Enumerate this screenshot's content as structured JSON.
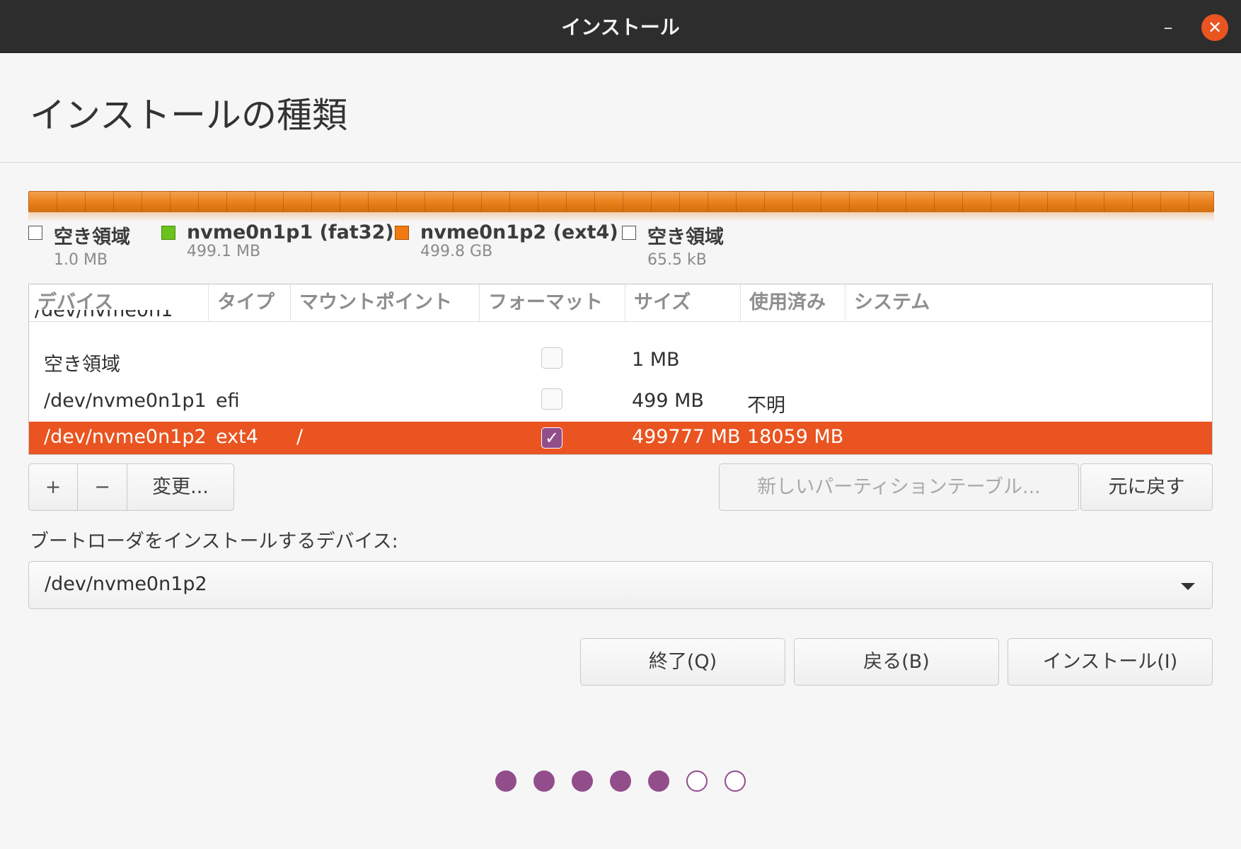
{
  "window": {
    "title": "インストール",
    "minimize_glyph": "–",
    "close_glyph": "✕"
  },
  "page": {
    "heading": "インストールの種類"
  },
  "legend": [
    {
      "name": "空き領域",
      "size": "1.0 MB",
      "color": "#ffffff"
    },
    {
      "name": "nvme0n1p1 (fat32)",
      "size": "499.1 MB",
      "color": "#6ac21c"
    },
    {
      "name": "nvme0n1p2 (ext4)",
      "size": "499.8 GB",
      "color": "#f07a10"
    },
    {
      "name": "空き領域",
      "size": "65.5 kB",
      "color": "#ffffff"
    }
  ],
  "table": {
    "columns": [
      "デバイス",
      "タイプ",
      "マウントポイント",
      "フォーマット",
      "サイズ",
      "使用済み",
      "システム"
    ],
    "group_label": "/dev/nvme0n1",
    "rows": [
      {
        "device": "空き領域",
        "type": "",
        "mount": "",
        "format": false,
        "size": "1 MB",
        "used": "",
        "system": ""
      },
      {
        "device": "/dev/nvme0n1p1",
        "type": "efi",
        "mount": "",
        "format": false,
        "size": "499 MB",
        "used": "不明",
        "system": ""
      },
      {
        "device": "/dev/nvme0n1p2",
        "type": "ext4",
        "mount": "/",
        "format": true,
        "size": "499777 MB",
        "used": "18059 MB",
        "system": "",
        "selected": true
      }
    ],
    "check_glyph": "✓"
  },
  "toolbar": {
    "add_label": "+",
    "remove_label": "−",
    "change_label": "変更...",
    "new_table_label": "新しいパーティションテーブル...",
    "revert_label": "元に戻す"
  },
  "bootloader": {
    "label": "ブートローダをインストールするデバイス:",
    "value": "/dev/nvme0n1p2"
  },
  "actions": {
    "quit_label": "終了(Q)",
    "back_label": "戻る(B)",
    "install_label": "インストール(I)"
  },
  "progress": {
    "total_steps": 7,
    "completed_steps": 5,
    "accent": "#924d8b"
  }
}
